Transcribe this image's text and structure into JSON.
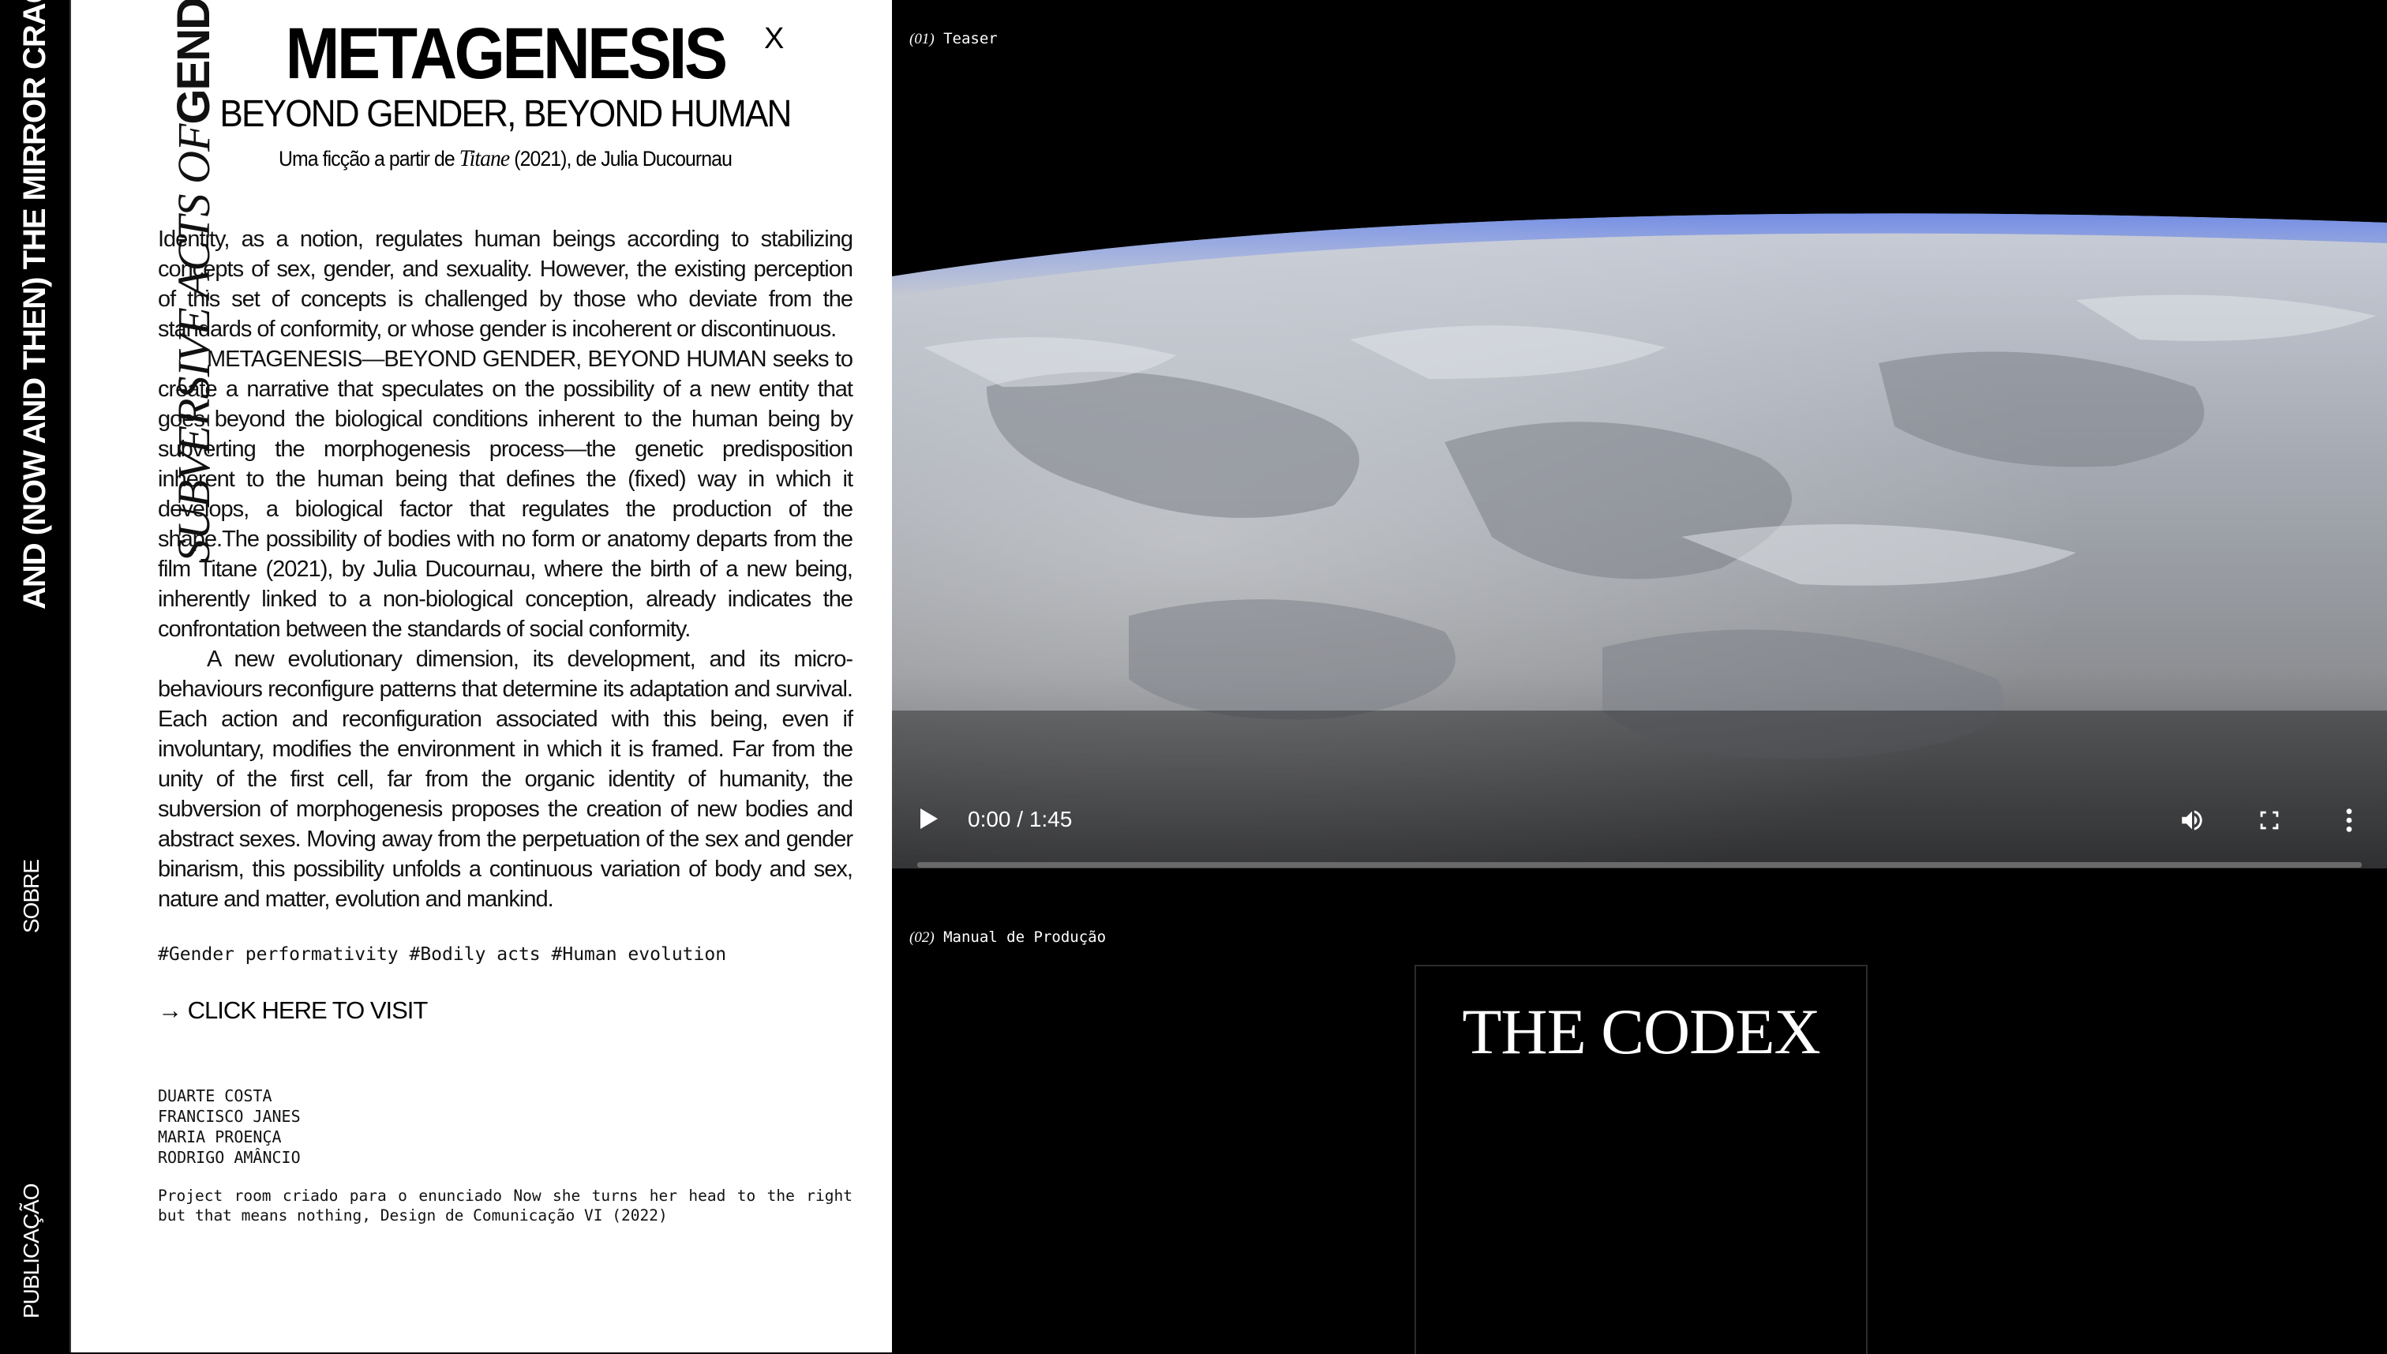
{
  "sidebar": {
    "title": "AND (NOW AND THEN) THE MIRROR CRACKED",
    "sobre": "SOBRE",
    "publicacao": "PUBLICAÇÃO"
  },
  "panel": {
    "vertical_italic": "SUBVERSIVE ACTS OF",
    "vertical_bold": "GENDER",
    "close_label": "X",
    "title": "METAGENESIS",
    "subtitle": "BEYOND GENDER, BEYOND HUMAN",
    "credit_prefix": "Uma ficção a partir de",
    "credit_film": "Titane",
    "credit_suffix": "(2021), de Julia Ducournau",
    "paragraphs": [
      "Identity, as a notion, regulates human beings according to stabilizing concepts of sex, gender, and sexuality. However, the existing perception of this set of concepts is challenged by those who deviate from the standards of conformity, or whose gender is incoherent or discontinuous.",
      "METAGENESIS—BEYOND GENDER, BEYOND HUMAN seeks to create a narrative that speculates on the possibility of a new entity that goes beyond the biological conditions inherent to the human being by subverting the morphogenesis process—the genetic predisposition inherent to the human being that defines the (fixed) way in which it develops, a biological factor that regulates the production of the shape.The possibility of bodies with no form or anatomy departs from the film Titane (2021), by Julia Ducournau, where the birth of a new being, inherently linked to a non-biological conception, already indicates the confrontation between the standards of social conformity.",
      "A new evolutionary dimension, its development, and its micro-behaviours reconfigure patterns that determine its adaptation and survival. Each action and reconfiguration associated with this being, even if involuntary, modifies the environment in which it is framed. Far from the unity of the first cell, far from the organic identity of humanity, the subversion of morphogenesis proposes the creation of new bodies and abstract sexes. Moving away from the perpetuation of the sex and gender binarism, this possibility unfolds a continuous variation of body and sex, nature and matter, evolution and mankind."
    ],
    "tags": "#Gender performativity #Bodily acts #Human evolution",
    "visit_link": "→ CLICK HERE TO VISIT",
    "authors": [
      "DUARTE COSTA",
      "FRANCISCO JANES",
      "MARIA PROENÇA",
      "RODRIGO AMÂNCIO"
    ],
    "footnote": "Project room criado para o enunciado Now she turns her head to the right but that means nothing, Design de Comunicação VI (2022)"
  },
  "media": {
    "teaser_num": "(01)",
    "teaser_label": "Teaser",
    "manual_num": "(02)",
    "manual_label": "Manual de Produção",
    "codex_title": "THE CODEX"
  },
  "video": {
    "time": "0:00 / 1:45",
    "progress": 0,
    "icons": [
      "play-icon",
      "volume-icon",
      "fullscreen-icon",
      "more-options-icon"
    ]
  },
  "colors": {
    "background": "#000000",
    "panel": "#ffffff",
    "text_dark": "#111111",
    "text_light": "#ffffff"
  }
}
